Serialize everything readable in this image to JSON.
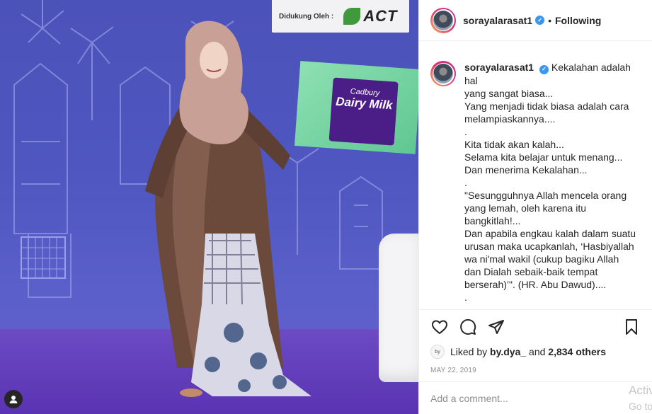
{
  "photo": {
    "sponsor_label": "Didukung Oleh :",
    "sponsor_logo": "ACT",
    "product_brand": "Cadbury",
    "product_name": "Dairy Milk",
    "badge_icon": "user-tag-icon"
  },
  "header": {
    "username": "sorayalarasat1",
    "separator": "•",
    "follow_status": "Following",
    "verified_icon": "verified-badge-icon"
  },
  "caption": {
    "author": "sorayalarasat1",
    "lines": [
      "Kekalahan adalah hal",
      "yang sangat biasa...",
      "Yang menjadi tidak biasa adalah cara",
      "melampiaskannya....",
      ".",
      "Kita tidak akan kalah...",
      "Selama kita belajar untuk menang...",
      "Dan menerima Kekalahan...",
      ".",
      "\"Sesungguhnya Allah mencela orang",
      "yang lemah, oleh karena itu",
      "bangkitlah!...",
      "Dan apabila engkau kalah dalam suatu",
      "urusan maka ucapkanlah, ‘Hasbiyallah",
      "wa ni'mal wakil (cukup bagiku Allah",
      "dan Dialah sebaik-baik tempat",
      "berserah)’\". (HR. Abu Dawud)....",
      ".",
      "."
    ]
  },
  "actions": {
    "like_icon": "heart-icon",
    "comment_icon": "comment-icon",
    "share_icon": "share-icon",
    "save_icon": "bookmark-icon"
  },
  "likes": {
    "prefix": "Liked by",
    "user": "by.dya_",
    "joiner": "and",
    "count": "2,834 others"
  },
  "date": "MAY 22, 2019",
  "comment": {
    "placeholder": "Add a comment..."
  },
  "watermark": {
    "line1": "Activate",
    "line2": "Go to Sett"
  }
}
